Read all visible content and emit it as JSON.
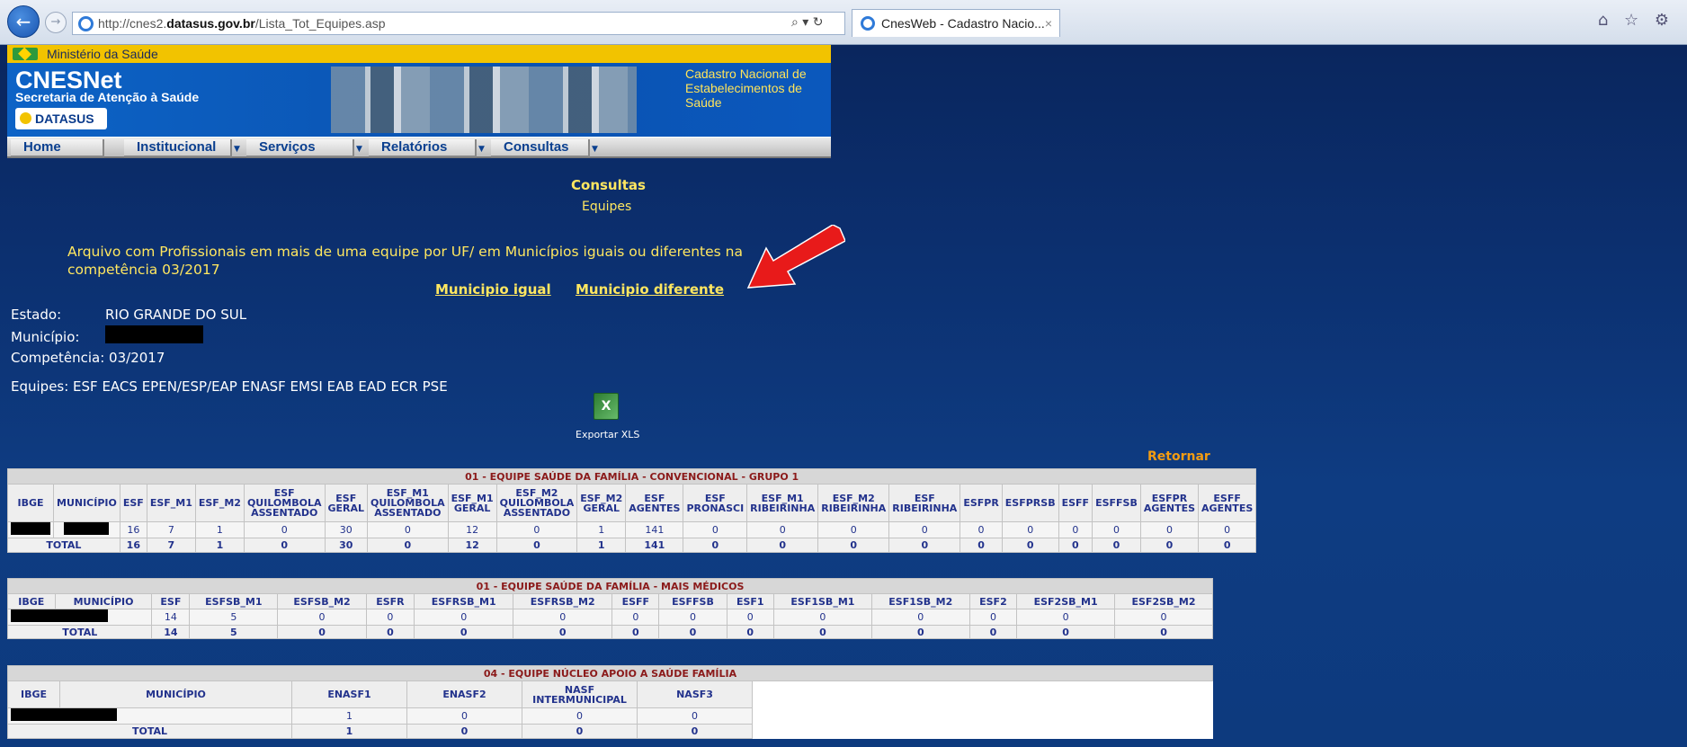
{
  "browser": {
    "url_prefix": "http://cnes2.",
    "url_domain": "datasus.gov.br",
    "url_path": "/Lista_Tot_Equipes.asp",
    "address_tools": "⌕ ▾ ↻",
    "tab_title": "CnesWeb - Cadastro Nacio...",
    "tab_close": "×",
    "toolbar_icons": "⌂ ☆ ⚙"
  },
  "site": {
    "ministry": "Ministério da Saúde",
    "brand": "CNESNet",
    "subtitle": "Secretaria de Atenção à Saúde",
    "datasus": "DATASUS",
    "cadastro": "Cadastro Nacional de Estabelecimentos de Saúde",
    "menu": [
      "Home",
      "Institucional",
      "Serviços",
      "Relatórios",
      "Consultas"
    ],
    "menu_arrow": "▼"
  },
  "page": {
    "title": "Consultas",
    "subtitle": "Equipes",
    "notice": "Arquivo com Profissionais em mais de uma equipe por UF/ em Municípios iguais ou diferentes na competência 03/2017",
    "link_igual": "Municipio igual",
    "link_diferente": "Municipio diferente",
    "estado_label": "Estado:",
    "estado_value": "RIO GRANDE DO SUL",
    "municipio_label": "Município:",
    "competencia": "Competência: 03/2017",
    "equipes": "Equipes: ESF EACS EPEN/ESP/EAP ENASF EMSI EAB EAD ECR PSE",
    "export_icon": "X",
    "export_label": "Exportar XLS",
    "retornar": "Retornar"
  },
  "colors": {
    "accent_yellow": "#ffe760",
    "retornar": "#f39c12",
    "header_red": "#8b1a1a",
    "cell_blue": "#22328c"
  },
  "table1": {
    "caption": "01 - EQUIPE SAÚDE DA FAMÍLIA - CONVENCIONAL - GRUPO 1",
    "headers": [
      "IBGE",
      "MUNICÍPIO",
      "ESF",
      "ESF_M1",
      "ESF_M2",
      "ESF QUILOMBOLA ASSENTADO",
      "ESF GERAL",
      "ESF_M1 QUILOMBOLA ASSENTADO",
      "ESF_M1 GERAL",
      "ESF_M2 QUILOMBOLA ASSENTADO",
      "ESF_M2 GERAL",
      "ESF AGENTES",
      "ESF PRONASCI",
      "ESF_M1 RIBEIRINHA",
      "ESF_M2 RIBEIRINHA",
      "ESF RIBEIRINHA",
      "ESFPR",
      "ESFPRSB",
      "ESFF",
      "ESFFSB",
      "ESFPR AGENTES",
      "ESFF AGENTES"
    ],
    "row": [
      "",
      "",
      "16",
      "7",
      "1",
      "0",
      "30",
      "0",
      "12",
      "0",
      "1",
      "141",
      "0",
      "0",
      "0",
      "0",
      "0",
      "0",
      "0",
      "0",
      "0",
      "0"
    ],
    "total_label": "TOTAL",
    "total": [
      "16",
      "7",
      "1",
      "0",
      "30",
      "0",
      "12",
      "0",
      "1",
      "141",
      "0",
      "0",
      "0",
      "0",
      "0",
      "0",
      "0",
      "0",
      "0",
      "0"
    ]
  },
  "table2": {
    "caption": "01 - EQUIPE SAÚDE DA FAMÍLIA - MAIS MÉDICOS",
    "headers": [
      "IBGE",
      "MUNICÍPIO",
      "ESF",
      "ESFSB_M1",
      "ESFSB_M2",
      "ESFR",
      "ESFRSB_M1",
      "ESFRSB_M2",
      "ESFF",
      "ESFFSB",
      "ESF1",
      "ESF1SB_M1",
      "ESF1SB_M2",
      "ESF2",
      "ESF2SB_M1",
      "ESF2SB_M2"
    ],
    "row": [
      "",
      "",
      "14",
      "5",
      "0",
      "0",
      "0",
      "0",
      "0",
      "0",
      "0",
      "0",
      "0",
      "0",
      "0",
      "0"
    ],
    "total_label": "TOTAL",
    "total": [
      "14",
      "5",
      "0",
      "0",
      "0",
      "0",
      "0",
      "0",
      "0",
      "0",
      "0",
      "0",
      "0",
      "0"
    ]
  },
  "table3": {
    "caption": "04 - EQUIPE NÚCLEO APOIO A SAÚDE FAMÍLIA",
    "headers": [
      "IBGE",
      "MUNICÍPIO",
      "ENASF1",
      "ENASF2",
      "NASF INTERMUNICIPAL",
      "NASF3"
    ],
    "row": [
      "",
      "",
      "1",
      "0",
      "0",
      "0"
    ],
    "total_label": "TOTAL",
    "total": [
      "1",
      "0",
      "0",
      "0"
    ]
  }
}
